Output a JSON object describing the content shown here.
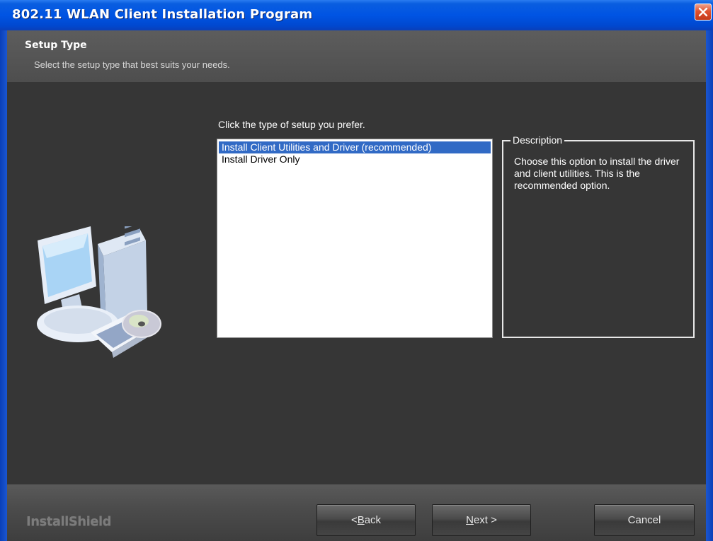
{
  "window": {
    "title": "802.11 WLAN Client Installation Program",
    "colors": {
      "titlebar": "#0054e3",
      "background": "#363636",
      "selection": "#316ac5"
    }
  },
  "header": {
    "title": "Setup Type",
    "subtitle": "Select the setup type that best suits your needs."
  },
  "main": {
    "prompt": "Click the type of setup you prefer.",
    "options": [
      {
        "label": "Install Client Utilities and Driver (recommended)",
        "selected": true
      },
      {
        "label": "Install Driver Only",
        "selected": false
      }
    ],
    "description": {
      "legend": "Description",
      "text": "Choose this option to install the driver and client utilities. This is the recommended option."
    },
    "illustration_icon": "computer-with-cd-icon"
  },
  "footer": {
    "brand": "InstallShield",
    "buttons": {
      "back": {
        "prefix": "< ",
        "accel": "B",
        "rest": "ack"
      },
      "next": {
        "accel": "N",
        "rest": "ext >"
      },
      "cancel": "Cancel"
    }
  }
}
